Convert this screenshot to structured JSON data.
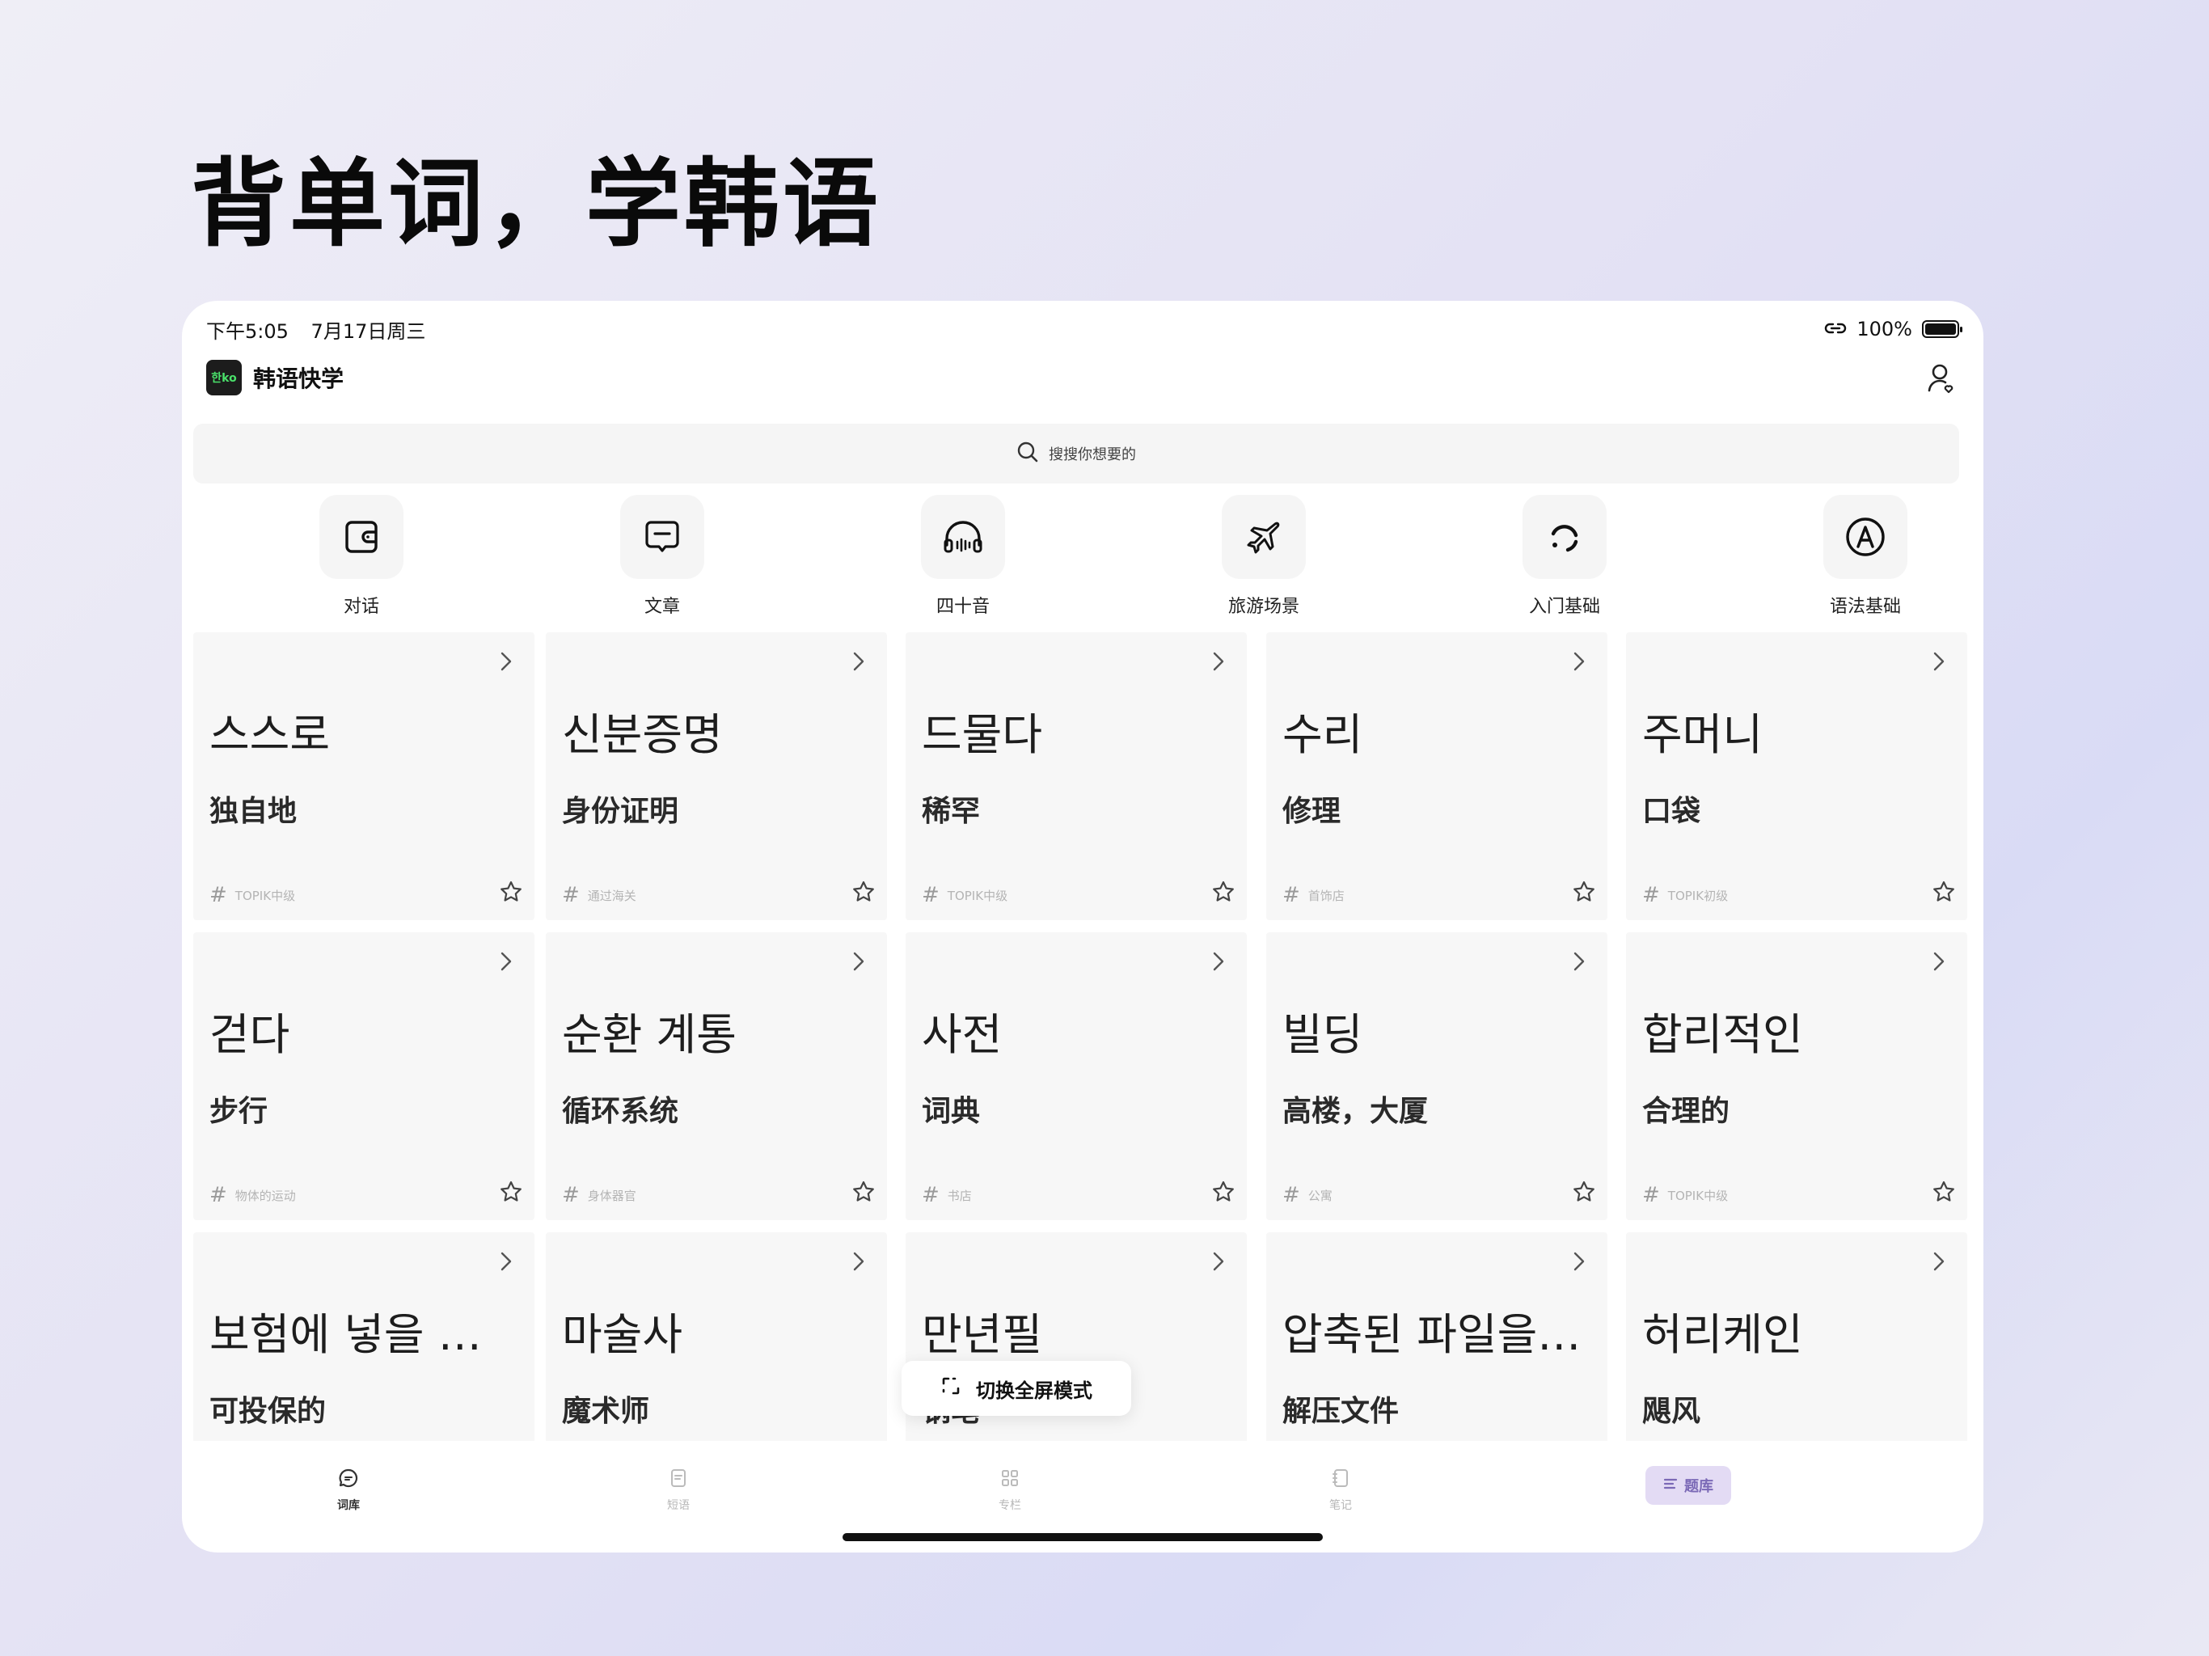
{
  "headline": "背单词，学韩语",
  "status_bar": {
    "time": "下午5:05",
    "date": "7月17日周三",
    "battery": "100%"
  },
  "app": {
    "logo_text": "한ko",
    "name": "韩语快学"
  },
  "search": {
    "placeholder": "搜搜你想要的"
  },
  "categories": [
    {
      "label": "对话",
      "icon": "wallet-icon"
    },
    {
      "label": "文章",
      "icon": "message-icon"
    },
    {
      "label": "四十音",
      "icon": "headphones-icon"
    },
    {
      "label": "旅游场景",
      "icon": "airplane-icon"
    },
    {
      "label": "入门基础",
      "icon": "loading-icon"
    },
    {
      "label": "语法基础",
      "icon": "letter-a-icon"
    }
  ],
  "cards": [
    {
      "word": "스스로",
      "meaning": "独自地",
      "tag": "TOPIK中级"
    },
    {
      "word": "신분증명",
      "meaning": "身份证明",
      "tag": "通过海关"
    },
    {
      "word": "드물다",
      "meaning": "稀罕",
      "tag": "TOPIK中级"
    },
    {
      "word": "수리",
      "meaning": "修理",
      "tag": "首饰店"
    },
    {
      "word": "주머니",
      "meaning": "口袋",
      "tag": "TOPIK初级"
    },
    {
      "word": "걷다",
      "meaning": "步行",
      "tag": "物体的运动"
    },
    {
      "word": "순환 계통",
      "meaning": "循环系统",
      "tag": "身体器官"
    },
    {
      "word": "사전",
      "meaning": "词典",
      "tag": "书店"
    },
    {
      "word": "빌딩",
      "meaning": "高楼，大厦",
      "tag": "公寓"
    },
    {
      "word": "합리적인",
      "meaning": "合理的",
      "tag": "TOPIK中级"
    },
    {
      "word": "보험에 넣을 수 있는",
      "meaning": "可投保的",
      "tag": ""
    },
    {
      "word": "마술사",
      "meaning": "魔术师",
      "tag": ""
    },
    {
      "word": "만년필",
      "meaning": "钢笔",
      "tag": ""
    },
    {
      "word": "압축된 파일을 풀다",
      "meaning": "解压文件",
      "tag": ""
    },
    {
      "word": "허리케인",
      "meaning": "飓风",
      "tag": ""
    }
  ],
  "toast": {
    "label": "切换全屏模式"
  },
  "tabs": [
    {
      "label": "词库",
      "icon": "chat-bubble-icon",
      "active": true
    },
    {
      "label": "短语",
      "icon": "document-icon",
      "active": false
    },
    {
      "label": "专栏",
      "icon": "grid-icon",
      "active": false
    },
    {
      "label": "笔记",
      "icon": "notebook-icon",
      "active": false
    }
  ],
  "tab_pill": {
    "label": "题库",
    "icon": "list-icon"
  },
  "colors": {
    "accent_pill_bg": "#e3dbf4",
    "accent_pill_text": "#7b69b6",
    "card_bg": "#f7f7f7"
  }
}
